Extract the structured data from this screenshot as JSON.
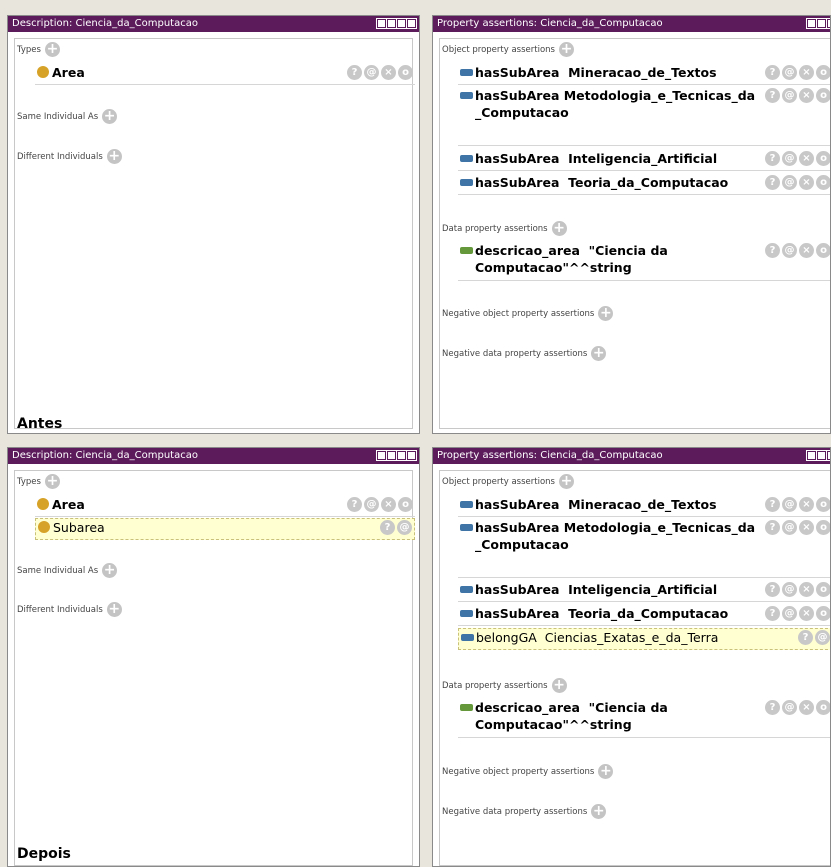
{
  "top": {
    "description": {
      "title": "Description: Ciencia_da_Computacao",
      "types_label": "Types",
      "types": [
        {
          "label": "Area"
        }
      ],
      "same_label": "Same Individual As",
      "different_label": "Different Individuals",
      "caption": "Antes"
    },
    "property": {
      "title": "Property assertions: Ciencia_da_Computacao",
      "object_label": "Object property assertions",
      "object_assertions": [
        {
          "prop": "hasSubArea",
          "value": "Mineracao_de_Textos"
        },
        {
          "prop": "hasSubArea",
          "value": "Metodologia_e_Tecnicas_da_Computacao"
        },
        {
          "prop": "hasSubArea",
          "value": "Inteligencia_Artificial"
        },
        {
          "prop": "hasSubArea",
          "value": "Teoria_da_Computacao"
        }
      ],
      "data_label": "Data property assertions",
      "data_assertions": [
        {
          "prop": "descricao_area",
          "value": "\"Ciencia da Computacao\"^^string"
        }
      ],
      "neg_object_label": "Negative object property assertions",
      "neg_data_label": "Negative data property assertions"
    }
  },
  "bottom": {
    "description": {
      "title": "Description: Ciencia_da_Computacao",
      "types_label": "Types",
      "types": [
        {
          "label": "Area"
        },
        {
          "label": "Subarea"
        }
      ],
      "same_label": "Same Individual As",
      "different_label": "Different Individuals",
      "caption": "Depois"
    },
    "property": {
      "title": "Property assertions: Ciencia_da_Computacao",
      "object_label": "Object property assertions",
      "object_assertions": [
        {
          "prop": "hasSubArea",
          "value": "Mineracao_de_Textos"
        },
        {
          "prop": "hasSubArea",
          "value": "Metodologia_e_Tecnicas_da_Computacao"
        },
        {
          "prop": "hasSubArea",
          "value": "Inteligencia_Artificial"
        },
        {
          "prop": "hasSubArea",
          "value": "Teoria_da_Computacao"
        },
        {
          "prop": "belongGA",
          "value": "Ciencias_Exatas_e_da_Terra"
        }
      ],
      "data_label": "Data property assertions",
      "data_assertions": [
        {
          "prop": "descricao_area",
          "value": "\"Ciencia da Computacao\"^^string"
        }
      ],
      "neg_object_label": "Negative object property assertions",
      "neg_data_label": "Negative data property assertions"
    }
  },
  "icons": {
    "plus": "+",
    "help": "?",
    "annotate": "@",
    "delete": "×",
    "edit": "o"
  },
  "colors": {
    "titlebar": "#5c1c5c",
    "individual": "#d7a228",
    "object_property": "#3e74a6",
    "data_property": "#64983a",
    "inferred_bg": "#ffffd2"
  }
}
